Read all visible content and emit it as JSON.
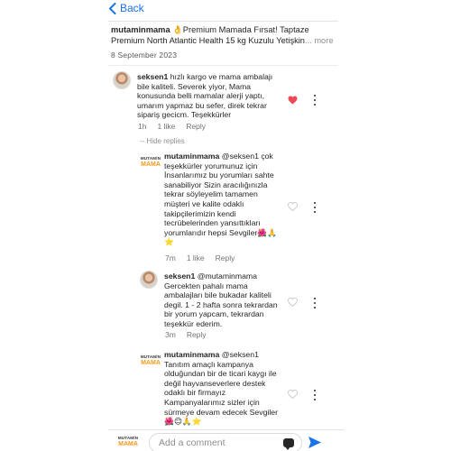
{
  "header": {
    "back_label": "Back"
  },
  "post": {
    "username": "mutaminmama",
    "emoji": "👌",
    "caption": "Premium Mamada Fırsat! Taptaze Premium North Atlantic Health 15 kg Kuzulu Yetişkin",
    "more_label": "... more",
    "date": "8 September 2023"
  },
  "comments": [
    {
      "username": "seksen1",
      "text": "hızlı kargo ve mama ambalajı bile kaliteli. Severek yiyor, Mama konusunda belli mamalar alerji yaptı, umarım yapmaz bu sefer, direk tekrar sipariş gecicm. Teşekkürler",
      "time": "1h",
      "likes": "1 like",
      "reply_label": "Reply",
      "liked": true,
      "hide_replies_label": "-- Hide replies"
    },
    {
      "username": "mutaminmama",
      "text": "@seksen1 çok teşekkürler yorumunuz için İnsanlarımız bu yorumları sahte sanabiliyor Sizin aracılığınızla tekrar söyleyelim tamamen müşteri ve kalite odaklı takipçilerimizin kendi tecrübelerinden yansıttıkları yorumlarıdır hepsi Sevgiler",
      "emojis_inline": "🌺🙏",
      "emojis_line": "⭐",
      "time": "7m",
      "likes": "1 like",
      "reply_label": "Reply",
      "liked": false
    },
    {
      "username": "seksen1",
      "text": "@mutaminmama Gercekten pahalı mama ambalajları bile bukadar kaliteli degil. 1 - 2 hafta sonra tekrardan bir yorum yapcam, tekrardan teşekkür ederim.",
      "time": "3m",
      "reply_label": "Reply",
      "liked": false
    },
    {
      "username": "mutaminmama",
      "text": "@seksen1 Tanıtım amaçlı kampanya olduğundan bir de ticari kaygı ile değil hayvanseverlere destek odaklı bir firmayız Kampanyalarımız sizler için sürmeye devam edecek Sevgiler",
      "emojis_line": "🌺😊🙏⭐",
      "liked": false
    }
  ],
  "brand_logo": {
    "line1": "MUTAMİN",
    "line2": "MAMA"
  },
  "composer": {
    "placeholder": "Add a comment"
  },
  "colors": {
    "link_blue": "#1a73e8",
    "heart_red": "#ed4956",
    "brand_orange": "#f39a1c",
    "send_blue": "#1a73e8"
  }
}
